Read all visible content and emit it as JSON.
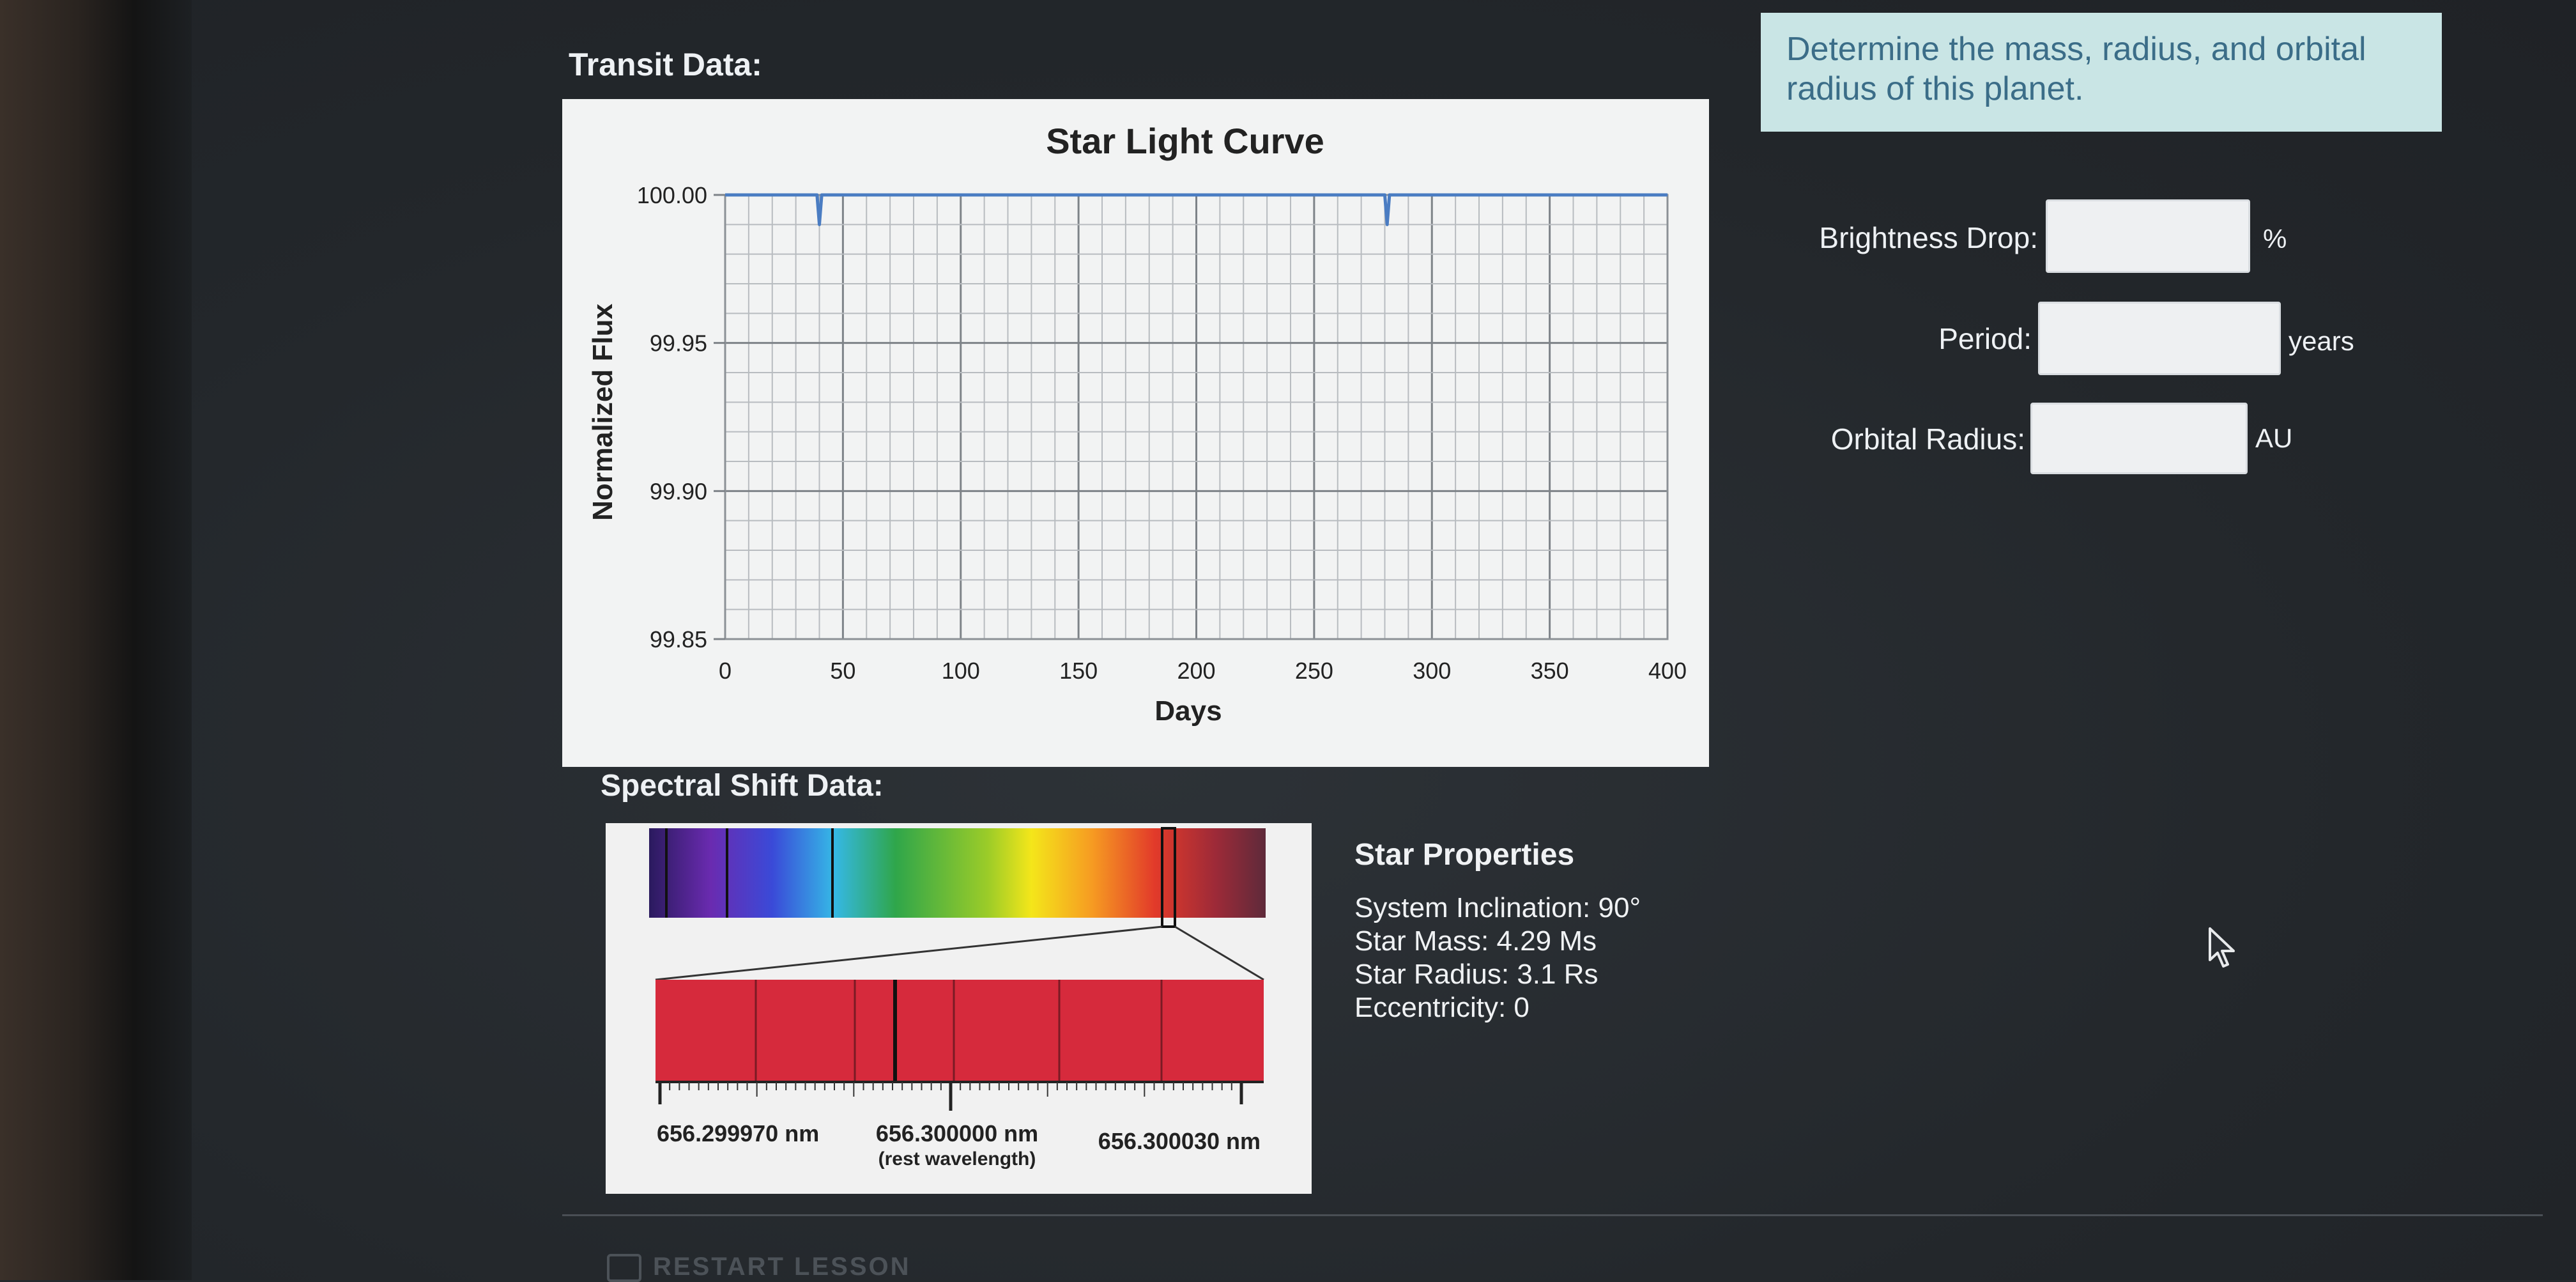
{
  "transit": {
    "label": "Transit Data:",
    "chart_data": {
      "type": "line",
      "title": "Star Light Curve",
      "xlabel": "Days",
      "ylabel": "Normalized Flux",
      "xlim": [
        0,
        400
      ],
      "ylim": [
        99.85,
        100.0
      ],
      "x_ticks": [
        "0",
        "50",
        "100",
        "150",
        "200",
        "250",
        "300",
        "350",
        "400"
      ],
      "y_ticks": [
        "100.00",
        "99.95",
        "99.90",
        "99.85"
      ],
      "grid": true,
      "series": [
        {
          "x": [
            0,
            39,
            40,
            41,
            280,
            281,
            282,
            400
          ],
          "y": [
            100.0,
            100.0,
            99.99,
            100.0,
            100.0,
            99.99,
            100.0,
            100.0
          ],
          "color": "#4a7cc2"
        }
      ]
    }
  },
  "spectral": {
    "label": "Spectral Shift Data:",
    "ticks": [
      "656.299970 nm",
      "656.300000 nm",
      "656.300030 nm"
    ],
    "rest_note": "(rest wavelength)"
  },
  "star_properties": {
    "title": "Star Properties",
    "inclination": "System Inclination: 90°",
    "mass": "Star Mass: 4.29 Ms",
    "radius": "Star Radius: 3.1 Rs",
    "eccentricity": "Eccentricity: 0"
  },
  "question": {
    "prompt": "Determine the mass, radius, and orbital radius of this planet."
  },
  "fields": {
    "brightness_drop": {
      "label": "Brightness Drop:",
      "value": "",
      "unit": "%"
    },
    "period": {
      "label": "Period:",
      "value": "",
      "unit": "years"
    },
    "orbital_radius": {
      "label": "Orbital Radius:",
      "value": "",
      "unit": "AU"
    }
  },
  "footer": {
    "restart_label": "RESTART LESSON"
  }
}
